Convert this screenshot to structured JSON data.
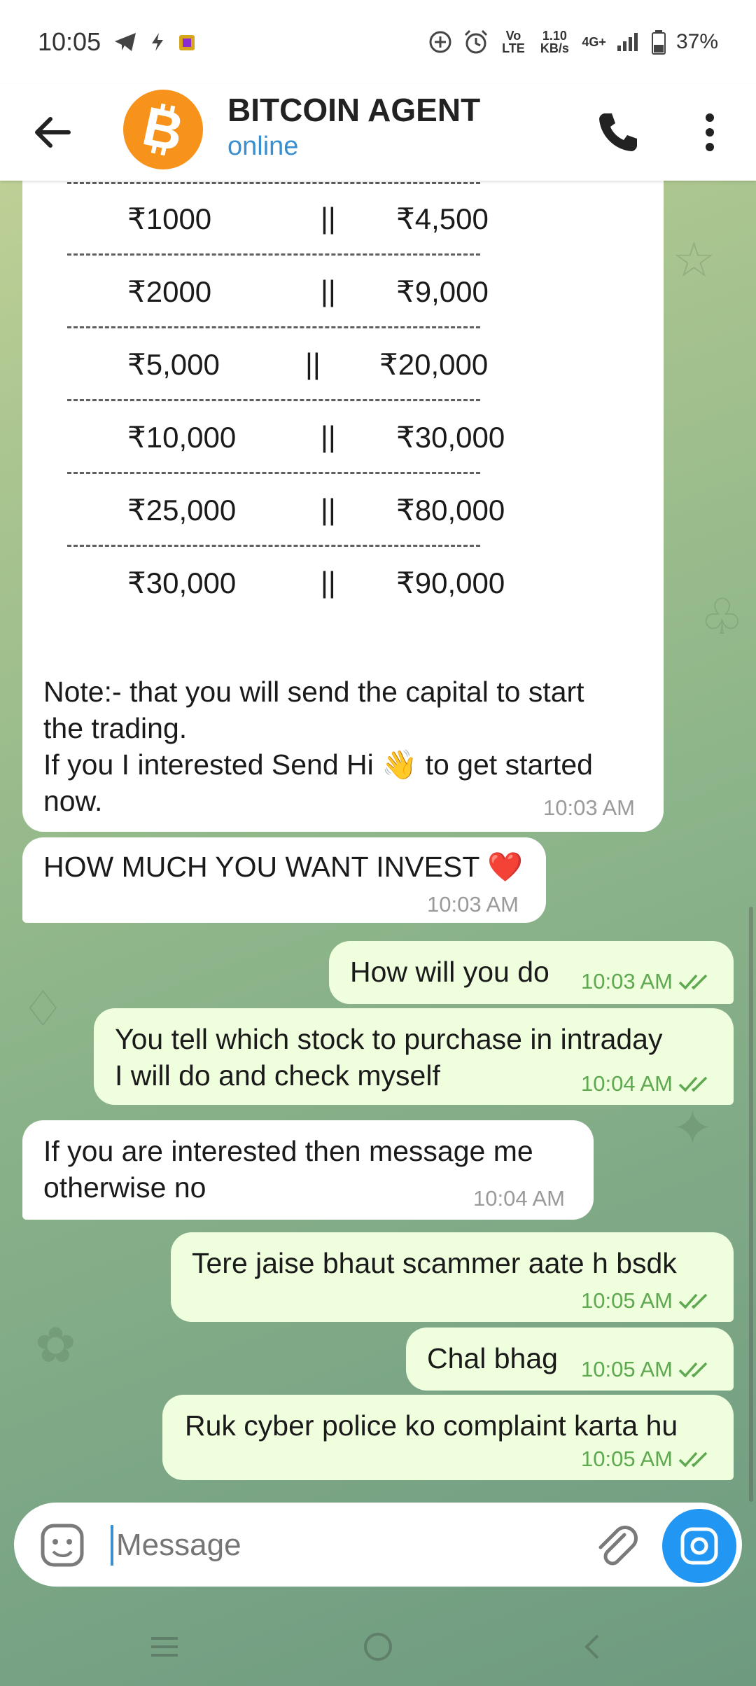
{
  "status_bar": {
    "time": "10:05",
    "volte": "Vo LTE",
    "speed": "1.10 KB/s",
    "network": "4G+",
    "battery": "37%"
  },
  "header": {
    "title": "BITCOIN AGENT",
    "status": "online"
  },
  "rate_table": [
    {
      "left": "₹1000",
      "sep": "||",
      "right": "₹4,500"
    },
    {
      "left": "₹2000",
      "sep": "||",
      "right": "₹9,000"
    },
    {
      "left": "₹5,000",
      "sep": "||",
      "right": "₹20,000"
    },
    {
      "left": "₹10,000",
      "sep": "||",
      "right": "₹30,000"
    },
    {
      "left": "₹25,000",
      "sep": "||",
      "right": "₹80,000"
    },
    {
      "left": "₹30,000",
      "sep": "||",
      "right": "₹90,000"
    }
  ],
  "messages": [
    {
      "dir": "in",
      "line1": "Note:-  that you will send the capital to start",
      "line2": "the trading.",
      "line3a": "If you I interested Send Hi ",
      "emoji": "👋",
      "line3b": " to get started",
      "line4": "now.",
      "time": "10:03 AM"
    },
    {
      "dir": "in",
      "text": "HOW MUCH YOU WANT INVEST ",
      "emoji": "❤️",
      "time": "10:03 AM"
    },
    {
      "dir": "out",
      "text": "How will you do",
      "time": "10:03 AM"
    },
    {
      "dir": "out",
      "line1": "You tell which stock to purchase in intraday",
      "line2": "I will do and check myself",
      "time": "10:04 AM"
    },
    {
      "dir": "in",
      "line1": "If you are interested then message me",
      "line2": "otherwise no",
      "time": "10:04 AM"
    },
    {
      "dir": "out",
      "text": "Tere jaise bhaut scammer aate h bsdk",
      "time": "10:05 AM"
    },
    {
      "dir": "out",
      "text": "Chal bhag",
      "time": "10:05 AM"
    },
    {
      "dir": "out",
      "text": "Ruk cyber police ko complaint karta hu",
      "time": "10:05 AM"
    }
  ],
  "composer": {
    "placeholder": "Message"
  },
  "icons": {
    "back": "arrow-left-icon",
    "call": "phone-icon",
    "menu": "more-vertical-icon",
    "sticker": "sticker-icon",
    "attach": "paperclip-icon",
    "camera": "camera-icon"
  },
  "colors": {
    "incoming": "#ffffff",
    "outgoing": "#effedd",
    "accent": "#3a8fd1",
    "bitcoin": "#f7931a",
    "tick": "#5ea84f"
  }
}
